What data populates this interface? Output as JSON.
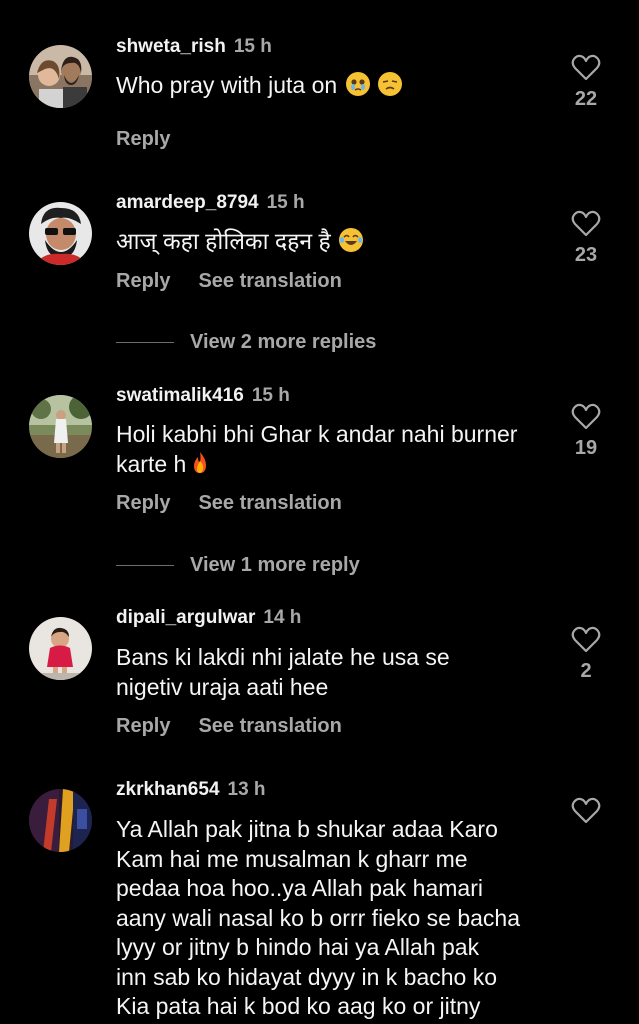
{
  "comments": [
    {
      "username": "shweta_rish",
      "time": "15 h",
      "text": "Who pray with juta on",
      "emojis": [
        "crying-face-emoji",
        "unamused-face-emoji"
      ],
      "likes": "22",
      "reply": "Reply"
    },
    {
      "username": "amardeep_8794",
      "time": "15 h",
      "text": "आज् कहा होलिका दहन है",
      "emojis": [
        "laughing-tears-emoji"
      ],
      "likes": "23",
      "reply": "Reply",
      "see_translation": "See translation",
      "view_more": "View 2 more replies"
    },
    {
      "username": "swatimalik416",
      "time": "15 h",
      "text_line1": "Holi kabhi bhi Ghar k andar nahi burner",
      "text_line2": "karte h",
      "emojis": [
        "fire-emoji"
      ],
      "likes": "19",
      "reply": "Reply",
      "see_translation": "See translation",
      "view_more": "View 1 more reply"
    },
    {
      "username": "dipali_argulwar",
      "time": "14 h",
      "text_line1": "Bans ki lakdi nhi jalate he usa se",
      "text_line2": "nigetiv uraja aati hee",
      "likes": "2",
      "reply": "Reply",
      "see_translation": "See translation"
    },
    {
      "username": "zkrkhan654",
      "time": "13 h",
      "lines": [
        "Ya Allah pak jitna b shukar adaa Karo",
        "Kam hai me musalman k gharr me",
        "pedaa hoa hoo..ya Allah pak hamari",
        "aany wali nasal ko b orrr fieko se bacha",
        "lyyy or jitny b hindo hai ya Allah pak",
        "inn sab ko hidayat dyyy in k bacho ko",
        "Kia pata hai k bod ko aag ko or jitny"
      ]
    }
  ],
  "colors": {
    "background": "#000000",
    "primary_text": "#f5f5f5",
    "secondary_text": "#a8a8a8"
  }
}
